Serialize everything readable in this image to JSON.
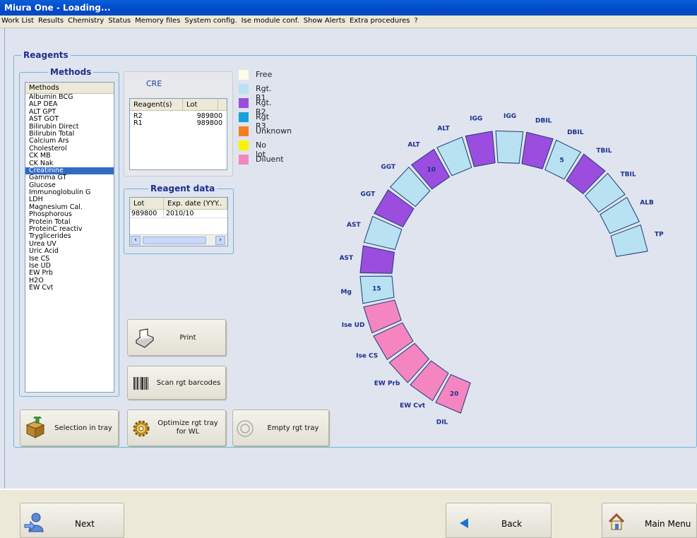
{
  "window": {
    "title": "Miura One - Loading..."
  },
  "menu": [
    "Work List",
    "Results",
    "Chemistry",
    "Status",
    "Memory files",
    "System config.",
    "Ise module conf.",
    "Show Alerts",
    "Extra procedures",
    "?"
  ],
  "reagents_group": {
    "label": "Reagents"
  },
  "methods_group": {
    "label": "Methods",
    "header": "Methods",
    "items": [
      "Albumin BCG",
      "ALP DEA",
      "ALT GPT",
      "AST GOT",
      "Bilirubin Direct",
      "Bilirubin Total",
      "Calcium Ars",
      "Cholesterol",
      "CK MB",
      "CK Nak",
      "Creatinine",
      "Gamma GT",
      "Glucose",
      "Immunoglobulin G",
      "LDH",
      "Magnesium Cal.",
      "Phosphorous",
      "Protein Total",
      "ProteinC reactiv",
      "Tryglicerides",
      "Urea UV",
      "Uric Acid",
      "Ise CS",
      "Ise UD",
      "EW Prb",
      "H2O",
      "EW Cvt"
    ],
    "selected": "Creatinine"
  },
  "method_detail": {
    "code": "CRE",
    "columns": [
      "Reagent(s)",
      "Lot"
    ],
    "rows": [
      [
        "R2",
        "989800"
      ],
      [
        "R1",
        "989800"
      ]
    ]
  },
  "reagent_data": {
    "label": "Reagent data",
    "columns": [
      "Lot",
      "Exp. date (YYY.."
    ],
    "rows": [
      [
        "989800",
        "2010/10"
      ]
    ]
  },
  "legend": [
    {
      "label": "Free",
      "color": "#fbfbe8"
    },
    {
      "label": "Rgt. R1",
      "color": "#b8e2f2"
    },
    {
      "label": "Rgt. R2",
      "color": "#9b4de0"
    },
    {
      "label": "Rgt R3",
      "color": "#1aa0d8"
    },
    {
      "label": "Unknown",
      "color": "#f57f20"
    },
    {
      "label": "No lot",
      "color": "#f8f400"
    },
    {
      "label": "Diluent",
      "color": "#f585c0"
    }
  ],
  "buttons": {
    "print": "Print",
    "scan": "Scan rgt barcodes",
    "selection": "Selection in tray",
    "optimize": "Optimize rgt tray for WL",
    "empty": "Empty rgt tray"
  },
  "nav": {
    "next": "Next",
    "back": "Back",
    "main_menu": "Main Menu"
  },
  "tray_positions": [
    {
      "label": "TP",
      "type": "Rgt. R1",
      "number": ""
    },
    {
      "label": "ALB",
      "type": "Rgt. R1",
      "number": ""
    },
    {
      "label": "TBIL",
      "type": "Rgt. R1",
      "number": ""
    },
    {
      "label": "TBIL",
      "type": "Rgt. R2",
      "number": ""
    },
    {
      "label": "DBIL",
      "type": "Rgt. R1",
      "number": "5"
    },
    {
      "label": "DBIL",
      "type": "Rgt. R2",
      "number": ""
    },
    {
      "label": "IGG",
      "type": "Rgt. R1",
      "number": ""
    },
    {
      "label": "IGG",
      "type": "Rgt. R2",
      "number": ""
    },
    {
      "label": "ALT",
      "type": "Rgt. R1",
      "number": ""
    },
    {
      "label": "ALT",
      "type": "Rgt. R2",
      "number": "10"
    },
    {
      "label": "GGT",
      "type": "Rgt. R1",
      "number": ""
    },
    {
      "label": "GGT",
      "type": "Rgt. R2",
      "number": ""
    },
    {
      "label": "AST",
      "type": "Rgt. R1",
      "number": ""
    },
    {
      "label": "AST",
      "type": "Rgt. R2",
      "number": ""
    },
    {
      "label": "Mg",
      "type": "Rgt. R1",
      "number": "15"
    },
    {
      "label": "Ise UD",
      "type": "Diluent",
      "number": ""
    },
    {
      "label": "Ise CS",
      "type": "Diluent",
      "number": ""
    },
    {
      "label": "EW Prb",
      "type": "Diluent",
      "number": ""
    },
    {
      "label": "EW Cvt",
      "type": "Diluent",
      "number": ""
    },
    {
      "label": "DIL",
      "type": "Diluent",
      "number": "20"
    }
  ]
}
